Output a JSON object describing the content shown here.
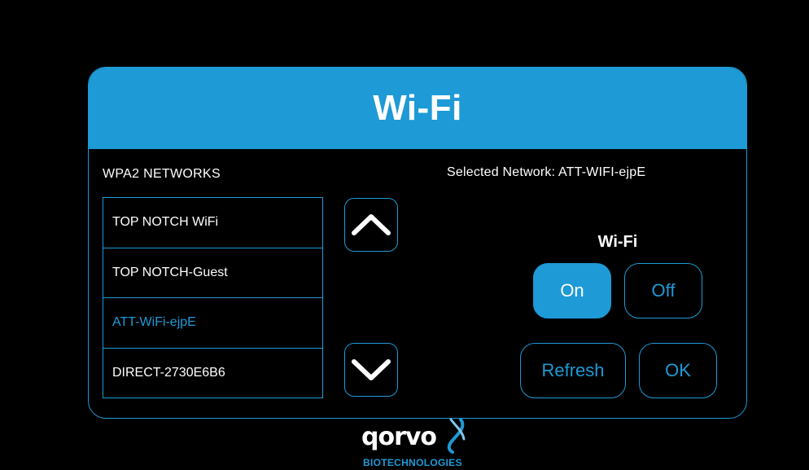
{
  "header": {
    "title": "Wi-Fi"
  },
  "networks": {
    "heading": "WPA2 NETWORKS",
    "items": [
      {
        "label": "TOP NOTCH WiFi"
      },
      {
        "label": "TOP NOTCH-Guest"
      },
      {
        "label": "ATT-WiFi-ejpE"
      },
      {
        "label": "DIRECT-2730E6B6"
      }
    ]
  },
  "status": {
    "selected_network": "Selected Network: ATT-WIFI-ejpE"
  },
  "wifi_toggle": {
    "label": "Wi-Fi",
    "on_label": "On",
    "off_label": "Off",
    "state": "On"
  },
  "actions": {
    "refresh_label": "Refresh",
    "ok_label": "OK"
  },
  "icons": {
    "scroll_up": "chevron-up-icon",
    "scroll_down": "chevron-down-icon"
  },
  "logo": {
    "wordmark": "qorvo",
    "subtitle": "BIOTECHNOLOGIES"
  },
  "colors": {
    "accent": "#1e9ad6",
    "background": "#000000",
    "text": "#ffffff"
  }
}
